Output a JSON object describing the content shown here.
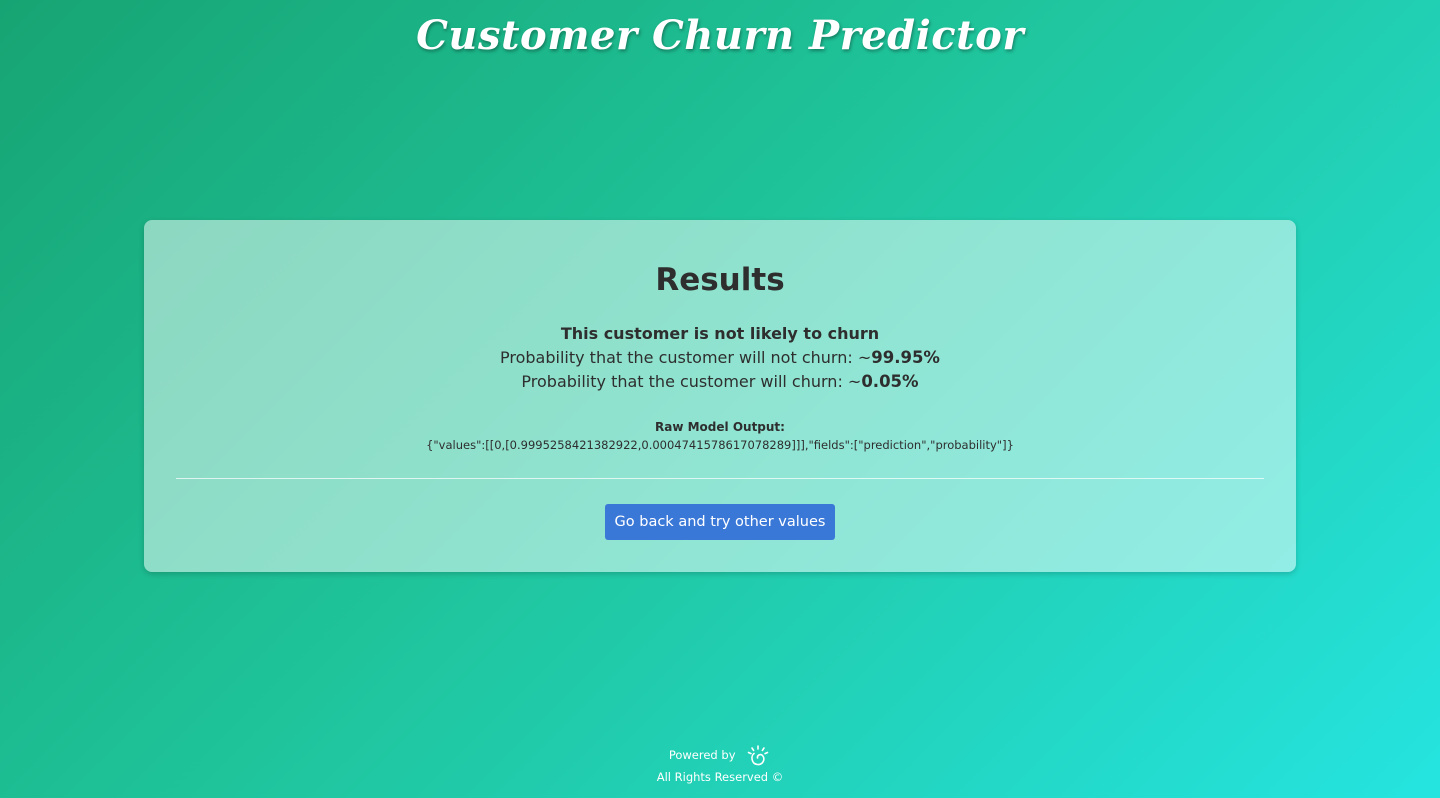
{
  "header": {
    "title": "Customer Churn Predictor"
  },
  "results": {
    "heading": "Results",
    "verdict": "This customer is not likely to churn",
    "not_churn_prefix": "Probability that the customer will not churn: ~",
    "not_churn_value": "99.95%",
    "churn_prefix": "Probability that the customer will churn: ~",
    "churn_value": "0.05%",
    "raw_label": "Raw Model Output:",
    "raw_value": "{\"values\":[[0,[0.9995258421382922,0.0004741578617078289]]],\"fields\":[\"prediction\",\"probability\"]}",
    "back_button_label": "Go back and try other values"
  },
  "footer": {
    "powered_by": "Powered by",
    "logo_icon": "watson-icon",
    "rights": "All Rights Reserved ©"
  },
  "colors": {
    "background_start": "#17a473",
    "background_end": "#25e4e0",
    "button": "#3a78d8"
  }
}
